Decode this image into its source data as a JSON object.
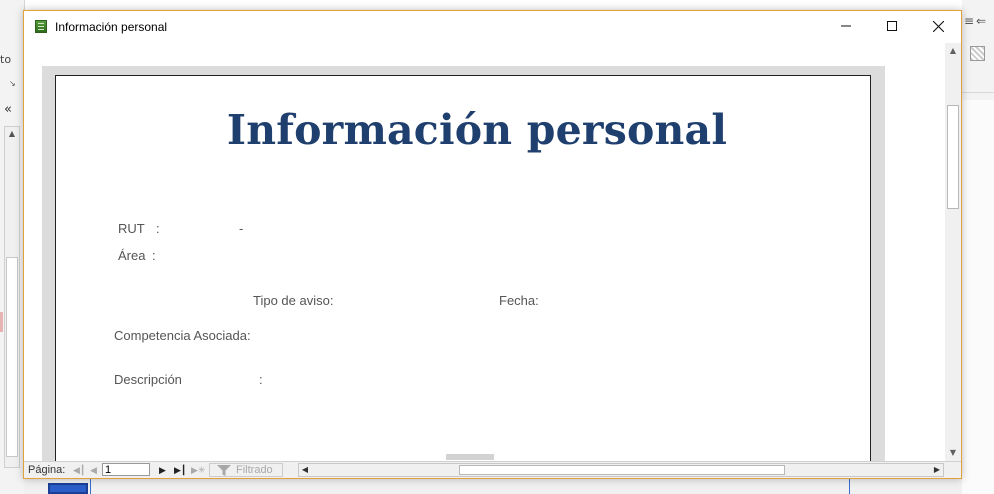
{
  "background": {
    "left_fragment_text": "to",
    "nav_collapse_icon": "double-chevron-left-icon"
  },
  "window": {
    "title": "Información personal",
    "accent_color": "#e0a23b"
  },
  "report": {
    "title": "Información personal",
    "title_color": "#1f3f6e",
    "fields": {
      "rut_label": "RUT",
      "rut_colon": ":",
      "rut_dash": "-",
      "area_label": "Área",
      "area_colon": ":",
      "tipo_aviso_label": "Tipo de aviso:",
      "fecha_label": "Fecha:",
      "competencia_label": "Competencia Asociada:",
      "descripcion_label": "Descripción",
      "descripcion_colon": ":"
    }
  },
  "navbar": {
    "page_label": "Página:",
    "page_value": "1",
    "filter_label": "Filtrado"
  }
}
